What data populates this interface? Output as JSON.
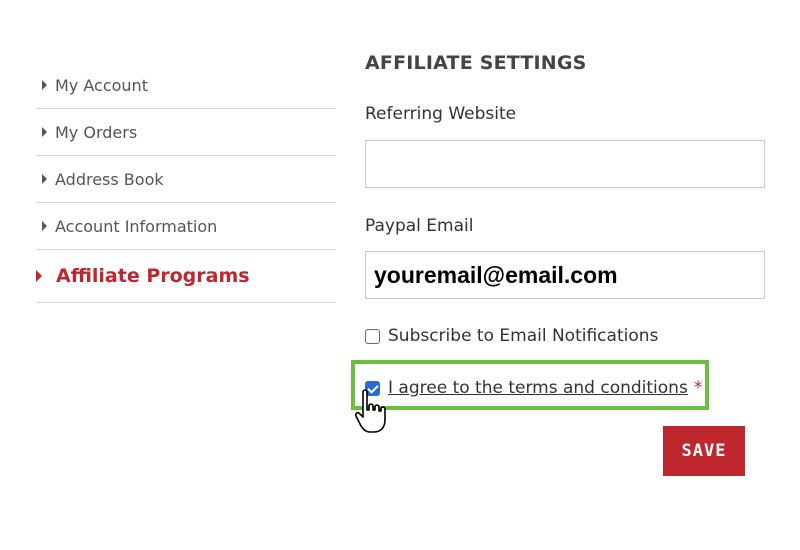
{
  "sidebar": {
    "items": [
      {
        "label": "My Account"
      },
      {
        "label": "My Orders"
      },
      {
        "label": "Address Book"
      },
      {
        "label": "Account Information"
      },
      {
        "label": "Affiliate Programs",
        "active": true
      }
    ]
  },
  "form": {
    "title": "AFFILIATE SETTINGS",
    "referring_label": "Referring Website",
    "referring_value": "",
    "paypal_label": "Paypal Email",
    "paypal_value": "youremail@email.com",
    "subscribe_label": "Subscribe to Email Notifications",
    "subscribe_checked": false,
    "terms_label": "I agree to the terms and conditions",
    "terms_checked": true,
    "required_mark": "*",
    "save_label": "SAVE"
  },
  "colors": {
    "accent": "#c0262d",
    "highlight": "#6abf3f",
    "checkbox": "#2b69d1"
  },
  "icons": {
    "cursor": "hand-pointer-icon",
    "caret": "caret-right-icon"
  }
}
